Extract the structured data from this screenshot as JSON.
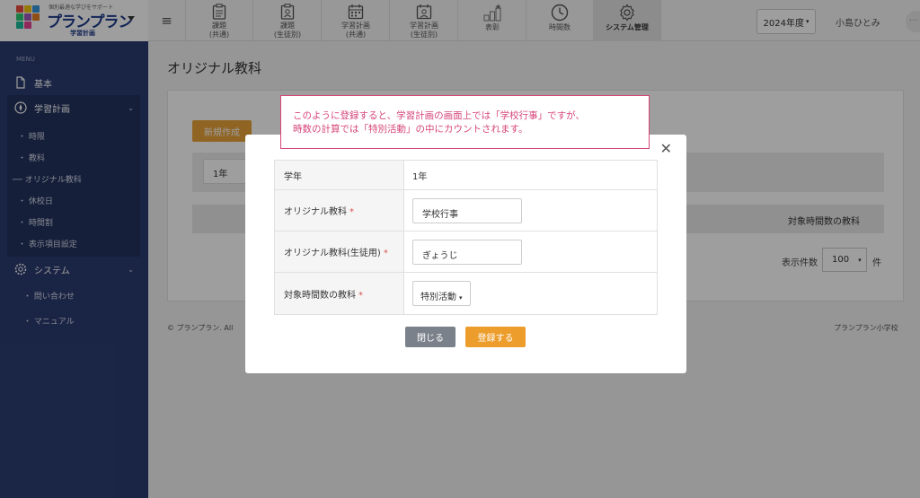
{
  "header": {
    "logo": {
      "tagline": "個別最適な学びをサポート",
      "name": "プランプラン",
      "subtitle": "学習計画"
    },
    "nav_tabs": [
      {
        "label": "課題\n(共通)",
        "icon": "clipboard-icon"
      },
      {
        "label": "課題\n(生徒別)",
        "icon": "student-clipboard-icon"
      },
      {
        "label": "学習計画\n(共通)",
        "icon": "calendar-icon"
      },
      {
        "label": "学習計画\n(生徒別)",
        "icon": "student-calendar-icon"
      },
      {
        "label": "表彰",
        "icon": "podium-icon"
      },
      {
        "label": "時間数",
        "icon": "clock-icon"
      },
      {
        "label": "システム管理",
        "icon": "gear-icon"
      }
    ],
    "year_select": "2024年度",
    "user_name": "小島ひとみ"
  },
  "sidebar": {
    "menu_label": "MENU",
    "items": [
      {
        "label": "基本",
        "icon": "file-icon"
      },
      {
        "label": "学習計画",
        "icon": "compass-icon"
      },
      {
        "label": "システム",
        "icon": "gear-icon"
      }
    ],
    "plan_links": [
      "時限",
      "教科",
      "オリジナル教科",
      "休校日",
      "時間割",
      "表示項目設定"
    ],
    "system_links": [
      "問い合わせ",
      "マニュアル"
    ]
  },
  "main": {
    "title": "オリジナル教科",
    "new_button": "新規作成",
    "grade_filter": "1年",
    "column_header": "対象時間数の教科",
    "count_label": "表示件数",
    "count_value": "100",
    "count_unit": "件",
    "footer_left": "© プランプラン. All",
    "footer_right": "プランプラン小学校"
  },
  "modal": {
    "rows": [
      {
        "label": "学年",
        "value": "1年",
        "required": false
      },
      {
        "label": "オリジナル教科",
        "value": "学校行事",
        "required": true
      },
      {
        "label": "オリジナル教科(生徒用)",
        "value": "ぎょうじ",
        "required": true
      },
      {
        "label": "対象時間数の教科",
        "value": "特別活動",
        "required": true
      }
    ],
    "required_mark": "*",
    "close_button": "閉じる",
    "save_button": "登録する"
  },
  "callout": {
    "line1": "このように登録すると、学習計画の画面上では「学校行事」ですが、",
    "line2": "時数の計算では「特別活動」の中にカウントされます。"
  },
  "colors": {
    "sidebar": "#2b3b6f",
    "accent": "#ec9d2c",
    "callout": "#d6457a",
    "close_button": "#7b818a"
  }
}
